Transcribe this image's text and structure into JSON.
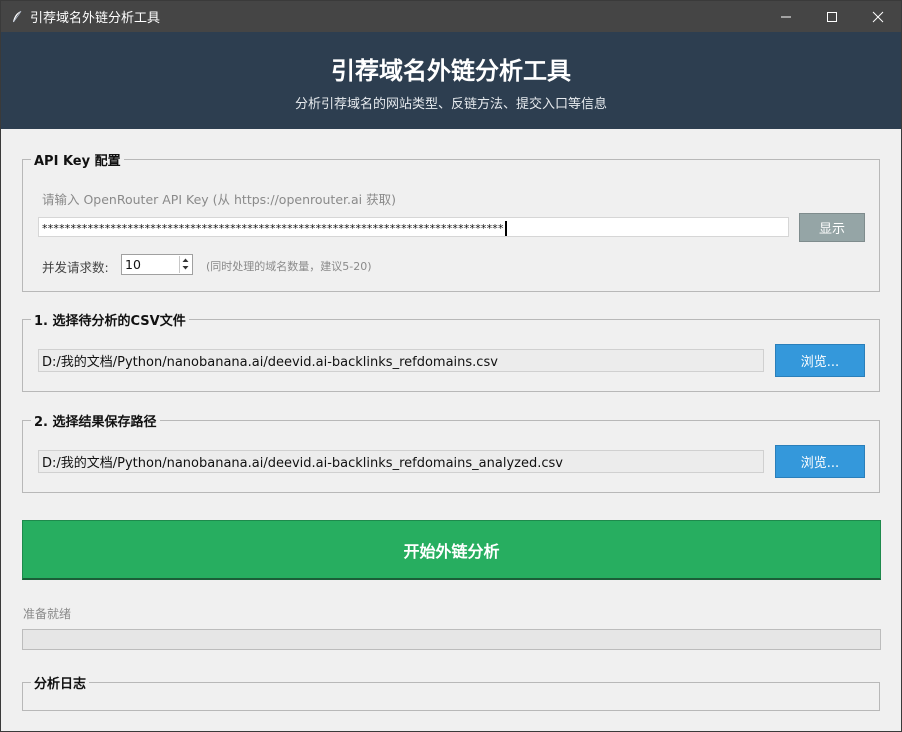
{
  "window": {
    "title": "引荐域名外链分析工具",
    "controls": [
      "minimize",
      "maximize",
      "close"
    ]
  },
  "header": {
    "title": "引荐域名外链分析工具",
    "subtitle": "分析引荐域名的网站类型、反链方法、提交入口等信息",
    "bg_color": "#2d3e50"
  },
  "api_section": {
    "legend": "API Key 配置",
    "hint": "请输入 OpenRouter API Key (从 https://openrouter.ai 获取)",
    "api_key_masked": "*********************************************************************************",
    "show_button": "显示",
    "concurrency_label": "并发请求数:",
    "concurrency_value": "10",
    "concurrency_hint": "(同时处理的域名数量，建议5-20)"
  },
  "csv_section": {
    "legend": "1. 选择待分析的CSV文件",
    "path": "D:/我的文档/Python/nanobanana.ai/deevid.ai-backlinks_refdomains.csv",
    "browse_button": "浏览..."
  },
  "save_section": {
    "legend": "2. 选择结果保存路径",
    "path": "D:/我的文档/Python/nanobanana.ai/deevid.ai-backlinks_refdomains_analyzed.csv",
    "browse_button": "浏览..."
  },
  "start_button": {
    "label": "开始外链分析",
    "color": "#27ae60"
  },
  "status": {
    "text": "准备就绪",
    "progress": 0
  },
  "log_section": {
    "legend": "分析日志"
  },
  "colors": {
    "browse": "#3498db",
    "show": "#95a5a6",
    "titlebar": "#454545"
  }
}
